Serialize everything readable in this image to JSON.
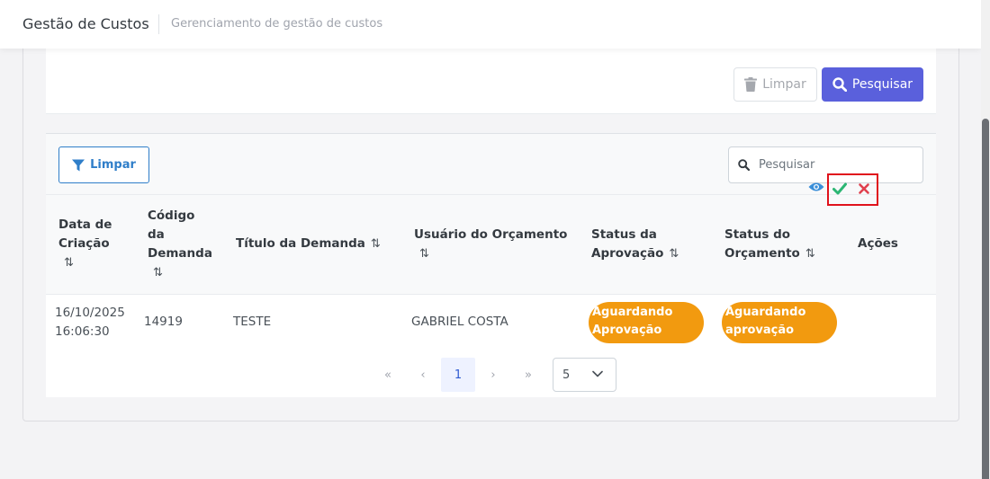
{
  "header": {
    "title": "Gestão de Custos",
    "subtitle": "Gerenciamento de gestão de custos"
  },
  "filters": {
    "clear_label": "Limpar",
    "search_label": "Pesquisar"
  },
  "table_toolbar": {
    "clear_filter_label": "Limpar",
    "search_placeholder": "Pesquisar"
  },
  "table": {
    "columns": [
      {
        "line1": "Data de",
        "line2": "Criação",
        "sortable": true
      },
      {
        "line1": "Código",
        "line2": "da",
        "line3": "Demanda",
        "sortable": true
      },
      {
        "line1": "Título da Demanda",
        "sortable": true
      },
      {
        "line1": "Usuário do Orçamento",
        "sortable": true
      },
      {
        "line1": "Status da",
        "line2": "Aprovação",
        "sortable": true
      },
      {
        "line1": "Status do",
        "line2": "Orçamento",
        "sortable": true
      },
      {
        "line1": "Ações",
        "sortable": false
      }
    ],
    "rows": [
      {
        "date": "16/10/2025",
        "time": "16:06:30",
        "code": "14919",
        "title": "TESTE",
        "user": "GABRIEL COSTA",
        "approval_status_line1": "Aguardando",
        "approval_status_line2": "Aprovação",
        "budget_status_line1": "Aguardando",
        "budget_status_line2": "aprovação",
        "actions": [
          "eye-icon",
          "check-icon",
          "close-icon"
        ]
      }
    ]
  },
  "pagination": {
    "first": "«",
    "prev": "‹",
    "current_page": "1",
    "next": "›",
    "last": "»",
    "page_size": "5"
  },
  "colors": {
    "primary": "#5a60dc",
    "accent_blue": "#2f7ec9",
    "status_badge": "#f29a0f",
    "approve_green": "#2bb673",
    "reject_red": "#e0404e",
    "highlight_box": "#e0121c"
  }
}
